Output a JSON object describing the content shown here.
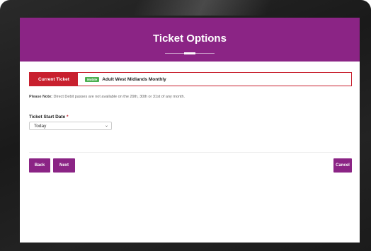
{
  "header": {
    "title": "Ticket Options"
  },
  "current_ticket": {
    "label": "Current Ticket",
    "badge": "Mobile",
    "name": "Adult West Midlands Monthly"
  },
  "note": {
    "prefix": "Please Note:",
    "text": " Direct Debit passes are not available on the 29th, 30th or 31st of any month."
  },
  "start_date": {
    "label": "Ticket Start Date",
    "required_mark": "*",
    "selected": "Today"
  },
  "buttons": {
    "back": "Back",
    "next": "Next",
    "cancel": "Cancel"
  },
  "colors": {
    "brand_purple": "#8b2485",
    "alert_red": "#c8202e",
    "badge_green": "#4caf50"
  },
  "icons": {
    "select": "chevron-down-icon"
  }
}
